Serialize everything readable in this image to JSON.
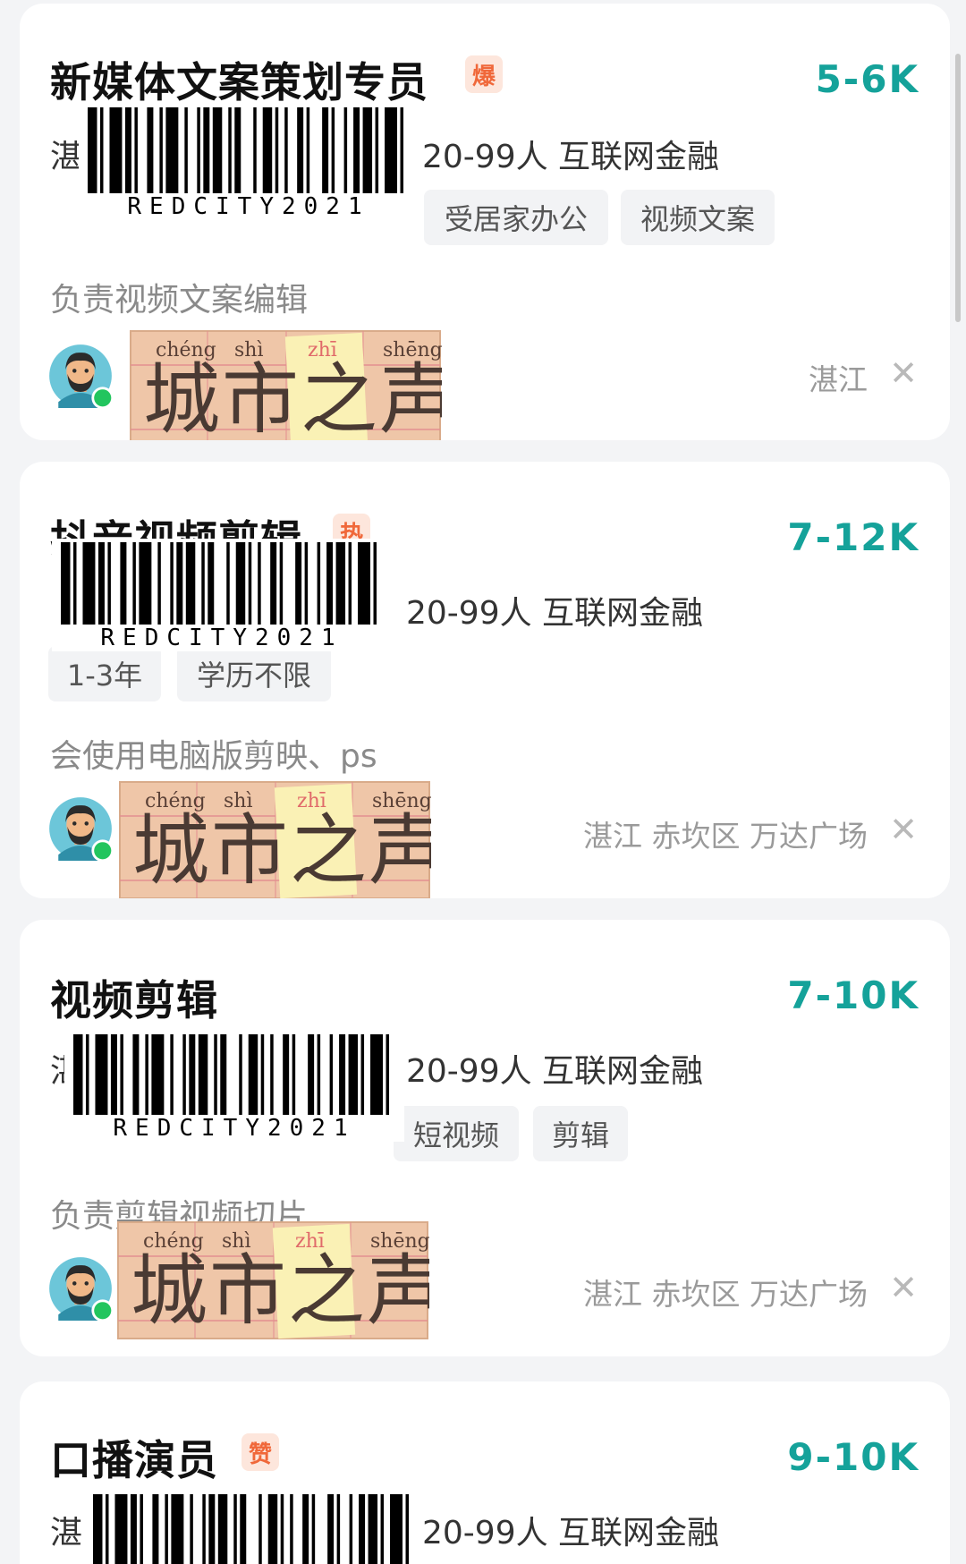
{
  "watermark": {
    "barcode_text": "REDCITY2021",
    "logo_text": "城市之声",
    "logo_pinyin": [
      "chéng",
      "shì",
      "zhī",
      "shēng"
    ]
  },
  "colors": {
    "salary": "#15a29a",
    "badge_bg": "#fde6dc",
    "badge_fg": "#f0683a",
    "tag_bg": "#f2f3f5",
    "online_dot": "#22c55e"
  },
  "jobs": [
    {
      "title": "新媒体文案策划专员",
      "badge": "爆",
      "salary": "5-6K",
      "company_prefix": "湛",
      "company_info": "20-99人 互联网金融",
      "tags": [
        "受居家办公",
        "视频文案"
      ],
      "description": "负责视频文案编辑",
      "location": "湛江",
      "avatar_icon": "recruiter-avatar-icon",
      "close_icon": "close-icon"
    },
    {
      "title": "抖音视频剪辑",
      "badge": "热",
      "salary": "7-12K",
      "company_info": "20-99人 互联网金融",
      "tags": [
        "1-3年",
        "学历不限"
      ],
      "description": "会使用电脑版剪映、ps",
      "location": "湛江 赤坎区 万达广场",
      "avatar_icon": "recruiter-avatar-icon",
      "close_icon": "close-icon"
    },
    {
      "title": "视频剪辑",
      "badge": "",
      "salary": "7-10K",
      "company_prefix": "湛",
      "company_info": "20-99人 互联网金融",
      "tags": [
        "短视频",
        "剪辑"
      ],
      "description": "负责剪辑视频切片",
      "location": "湛江 赤坎区 万达广场",
      "avatar_icon": "recruiter-avatar-icon",
      "close_icon": "close-icon"
    },
    {
      "title": "口播演员",
      "badge": "赞",
      "salary": "9-10K",
      "company_prefix": "湛",
      "company_info": "20-99人 互联网金融"
    }
  ]
}
